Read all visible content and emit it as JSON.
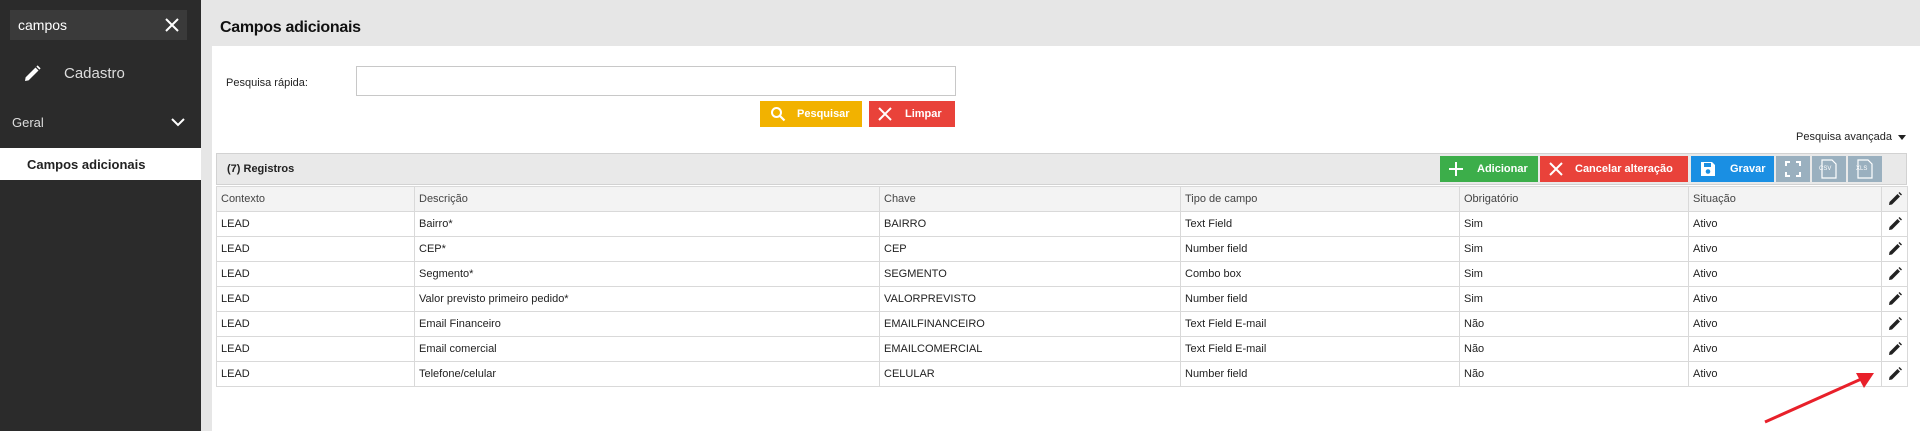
{
  "sidebar": {
    "search_value": "campos",
    "cadastro_label": "Cadastro",
    "group_label": "Geral",
    "active_item_label": "Campos adicionais"
  },
  "page": {
    "title": "Campos adicionais",
    "quick_search_label": "Pesquisa rápida:",
    "quick_search_value": "",
    "search_button": "Pesquisar",
    "clear_button": "Limpar",
    "advanced_search": "Pesquisa avançada"
  },
  "grid": {
    "record_count": "(7) Registros",
    "add_button": "Adicionar",
    "cancel_button": "Cancelar alteração",
    "save_button": "Gravar",
    "columns": [
      "Contexto",
      "Descrição",
      "Chave",
      "Tipo de campo",
      "Obrigatório",
      "Situação"
    ],
    "rows": [
      [
        "LEAD",
        "Bairro*",
        "BAIRRO",
        "Text Field",
        "Sim",
        "Ativo"
      ],
      [
        "LEAD",
        "CEP*",
        "CEP",
        "Number field",
        "Sim",
        "Ativo"
      ],
      [
        "LEAD",
        "Segmento*",
        "SEGMENTO",
        "Combo box",
        "Sim",
        "Ativo"
      ],
      [
        "LEAD",
        "Valor previsto primeiro pedido*",
        "VALORPREVISTO",
        "Number field",
        "Sim",
        "Ativo"
      ],
      [
        "LEAD",
        "Email Financeiro",
        "EMAILFINANCEIRO",
        "Text Field E-mail",
        "Não",
        "Ativo"
      ],
      [
        "LEAD",
        "Email comercial",
        "EMAILCOMERCIAL",
        "Text Field E-mail",
        "Não",
        "Ativo"
      ],
      [
        "LEAD",
        "Telefone/celular",
        "CELULAR",
        "Number field",
        "Não",
        "Ativo"
      ]
    ]
  },
  "icons": {
    "csv": "CSV",
    "xls": "XLS"
  },
  "colors": {
    "sidebar_bg": "#2b2b2b",
    "search_btn": "#f2b200",
    "danger_btn": "#e9423a",
    "add_btn": "#3cae4a",
    "save_btn": "#1a8fe3",
    "annotation_arrow": "#e8202a"
  }
}
